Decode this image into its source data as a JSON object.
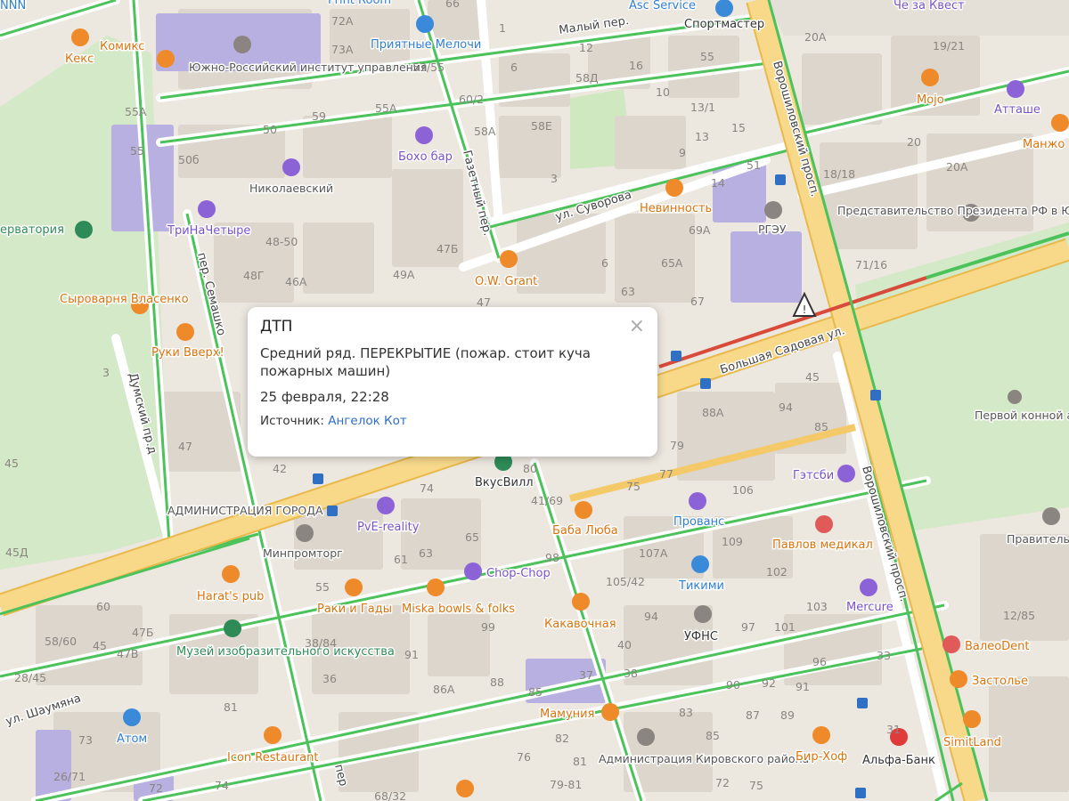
{
  "popup": {
    "title": "ДТП",
    "description": "Средний ряд. ПЕРЕКРЫТИЕ (пожар. стоит куча пожарных машин)",
    "date": "25 февраля, 22:28",
    "source_label": "Источник:",
    "source_author": "Ангелок Кот",
    "close_symbol": "×"
  },
  "streets": {
    "sadovaya": "Большая Садовая ул.",
    "voroshilovsky_top": "Ворошиловский просп.",
    "voroshilovsky_bottom": "Ворошиловский просп.",
    "suvorova": "ул. Суворова",
    "gazetny": "Газетный пер.",
    "semashko": "пер. Семашко",
    "dumsky": "Думский пр.д",
    "maly": "Малый пер.",
    "shaumyana": "ул. Шаумяна",
    "per_bottom": "пер"
  },
  "places": {
    "keks": "Кекс",
    "komiks": "Комикс",
    "institute": "Южно-Российский институт управления",
    "priyatnye": "Приятные Мелочи",
    "asc": "Asc Service",
    "sportmaster": "Спортмастер",
    "chezakvest": "Че за Квест",
    "mojo": "Mojo",
    "attashe": "Атташе",
    "manzho": "Манжо",
    "boho": "Бохо бар",
    "nikolaevsky": "Николаевский",
    "nevinnost": "Невинность",
    "rgeu": "РГЭУ",
    "predstavitelstvo": "Представительство Президента РФ в ЮФО",
    "observatoria": "ерватория",
    "trinachetyre": "ТриНаЧетыре",
    "owgrant": "O.W. Grant",
    "syrovarnya": "Сыроварня Власенко",
    "rukivverh": "Руки Вверх!",
    "pervoy_konnoy": "Первой конной армии",
    "administration": "АДМИНИСТРАЦИЯ ГОРОДА",
    "vkusvill": "ВкусВилл",
    "getsbi": "Гэтсби",
    "provans": "Прованс",
    "pve": "PvE-reality",
    "babalyuba": "Баба Люба",
    "pavlov": "Павлов медикал",
    "minpromtorg": "Минпромторг",
    "pravitelstvo": "Правитель облас",
    "chopchop": "Chop-Chop",
    "harats": "Harat's pub",
    "rakiigady": "Раки и Гады",
    "miska": "Miska bowls & folks",
    "tikimi": "Тикими",
    "mercure": "Mercure",
    "kakavochnaya": "Какавочная",
    "ufns": "УФНС",
    "valeodent": "ВалеоDent",
    "museum": "Музей изобразительного искусства",
    "zastolye": "Застолье",
    "mamuniya": "Мамуния",
    "atom": "Атом",
    "simitland": "SimitLand",
    "iconrest": "Icon Restaurant",
    "admkirov": "Администрация Кировского района",
    "birhof": "Бир-Хоф",
    "alfabank": "Альфа-Банк",
    "nnn": "NNN",
    "printroom": "Print Room"
  },
  "house_numbers": {
    "n72a": "72А",
    "n73a": "73А",
    "n66": "66",
    "n1": "1",
    "n53_55": "53/55",
    "n6": "6",
    "n12": "12",
    "n55top": "55",
    "n20a": "20А",
    "n19_21": "19/21",
    "n58d": "58Д",
    "n16": "16",
    "n10": "10",
    "n13_1": "13/1",
    "n55a": "55А",
    "n50": "50",
    "n59": "59",
    "n55a2": "55А",
    "n60_2": "60/2",
    "n58a": "58А",
    "n58e": "58Е",
    "n13": "13",
    "n15": "15",
    "n55": "55",
    "n50b": "50б",
    "n51": "51",
    "n18_18": "18/18",
    "n20a2": "20А",
    "n20": "20",
    "n3": "3",
    "n14": "14",
    "n9": "9",
    "n48_50": "48-50",
    "n47b": "47Б",
    "n48g": "48Г",
    "n46a": "46А",
    "n49a": "49А",
    "n6b": "6",
    "n65a": "65А",
    "n69a": "69А",
    "n71_16": "71/16",
    "n63": "63",
    "n67": "67",
    "n47": "47",
    "n45": "45",
    "n3b": "3",
    "n47c": "47",
    "n45b": "45",
    "n88a": "88А",
    "n94": "94",
    "n85": "85",
    "n79": "79",
    "n77": "77",
    "n42": "42",
    "n80": "80",
    "n74": "74",
    "n75": "75",
    "n106": "106",
    "n41_69": "41/69",
    "n65": "65",
    "n109": "109",
    "n45d": "45Д",
    "n107a": "107А",
    "n61": "61",
    "n63b": "63",
    "n98": "98",
    "n102": "102",
    "n60": "60",
    "n47b2": "47Б",
    "n55b": "55",
    "n105_42": "105/42",
    "n103": "103",
    "n58_60": "58/60",
    "n45c": "45",
    "n47v": "47В",
    "n38_84": "38/84",
    "n99": "99",
    "n94b": "94",
    "n97": "97",
    "n101": "101",
    "n28_45": "28/45",
    "n40": "40",
    "n96": "96",
    "n33": "33",
    "n91": "91",
    "n36": "36",
    "n81": "81",
    "n86a": "86А",
    "n88": "88",
    "n85b": "85",
    "n37": "37",
    "n38": "38",
    "n90": "90",
    "n92": "92",
    "n91b": "91",
    "n12_85": "12/85",
    "n73": "73",
    "n83": "83",
    "n82": "82",
    "n85c": "85",
    "n87": "87",
    "n89": "89",
    "n26_71": "26/71",
    "n72": "72",
    "n74b": "74",
    "n76": "76",
    "n81b": "81",
    "n79_81": "79-81",
    "n68_32": "68/32",
    "n72b": "72",
    "n31": "31"
  },
  "colors": {
    "background": "#ece7df",
    "building": "#dcd6cd",
    "park": "#d4e9c7",
    "major_road": "#f8d98a",
    "major_road_edge": "#e9b94c",
    "traffic_green": "#4cc25a",
    "traffic_red": "#d84a3a",
    "purple_building": "#b8b0e0",
    "poi_orange": "#ee8a2a",
    "poi_purple": "#8b63d6",
    "poi_blue": "#3b8ad9"
  }
}
